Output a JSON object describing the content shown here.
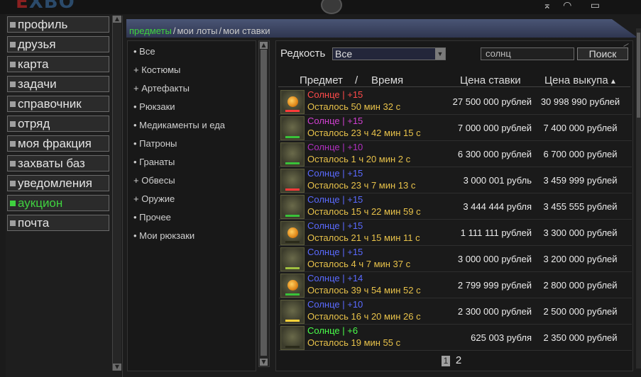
{
  "app": {
    "logo_a": "E",
    "logo_b": "XBO"
  },
  "tray": {
    "signal_icon": "antenna-icon",
    "wifi_icon": "wifi-icon",
    "battery_icon": "battery-icon"
  },
  "nav": {
    "items": [
      {
        "label": "профиль"
      },
      {
        "label": "друзья"
      },
      {
        "label": "карта"
      },
      {
        "label": "задачи"
      },
      {
        "label": "справочник"
      },
      {
        "label": "отряд"
      },
      {
        "label": "моя фракция"
      },
      {
        "label": "захваты баз"
      },
      {
        "label": "уведомления"
      },
      {
        "label": "аукцион",
        "active": true
      },
      {
        "label": "почта"
      }
    ]
  },
  "tabs": {
    "items": [
      "предметы",
      "мои лоты",
      "мои ставки"
    ],
    "separator": "/"
  },
  "categories": [
    "• Все",
    "+ Костюмы",
    "+ Артефакты",
    "• Рюкзаки",
    "• Медикаменты и еда",
    "• Патроны",
    "• Гранаты",
    "+ Обвесы",
    "+ Оружие",
    "• Прочее",
    "• Мои рюкзаки"
  ],
  "filter": {
    "rarity_label": "Редкость",
    "rarity_value": "Все",
    "search_value": "солнц",
    "search_button": "Поиск"
  },
  "table": {
    "headers": {
      "item": "Предмет",
      "slash": "/",
      "time": "Время",
      "bid": "Цена ставки",
      "buyout": "Цена выкупа",
      "sort_indicator": "▴"
    },
    "rows": [
      {
        "name": "Солнце | +15",
        "name_color": "#ff4a4a",
        "remaining": "Осталось 50 мин 32 с",
        "bid": "27 500 000 рублей",
        "buyout": "30 998 990 рублей",
        "bar_color": "#ff3a3a",
        "has_orb": true
      },
      {
        "name": "Солнце | +15",
        "name_color": "#d040d0",
        "remaining": "Осталось 23 ч 42 мин 15 с",
        "bid": "7 000 000 рублей",
        "buyout": "7 400 000 рублей",
        "bar_color": "#39c239",
        "has_orb": false
      },
      {
        "name": "Солнце | +10",
        "name_color": "#b030c0",
        "remaining": "Осталось 1 ч 20 мин 2 с",
        "bid": "6 300 000 рублей",
        "buyout": "6 700 000 рублей",
        "bar_color": "#39c239",
        "has_orb": false
      },
      {
        "name": "Солнце | +15",
        "name_color": "#5a6aff",
        "remaining": "Осталось 23 ч 7 мин 13 с",
        "bid": "3 000 001 рубль",
        "buyout": "3 459 999 рублей",
        "bar_color": "#ff3a3a",
        "has_orb": false
      },
      {
        "name": "Солнце | +15",
        "name_color": "#5a6aff",
        "remaining": "Осталось 15 ч 22 мин 59 с",
        "bid": "3 444 444 рубля",
        "buyout": "3 455 555 рублей",
        "bar_color": "#39c239",
        "has_orb": false
      },
      {
        "name": "Солнце | +15",
        "name_color": "#5a6aff",
        "remaining": "Осталось 21 ч 15 мин 11 с",
        "bid": "1 111 111 рублей",
        "buyout": "3 300 000 рублей",
        "bar_color": "#2a2a1a",
        "has_orb": true
      },
      {
        "name": "Солнце | +15",
        "name_color": "#5a6aff",
        "remaining": "Осталось 4 ч 7 мин 37 с",
        "bid": "3 000 000 рублей",
        "buyout": "3 200 000 рублей",
        "bar_color": "#a0c040",
        "has_orb": false
      },
      {
        "name": "Солнце | +14",
        "name_color": "#5a6aff",
        "remaining": "Осталось 39 ч 54 мин 52 с",
        "bid": "2 799 999 рублей",
        "buyout": "2 800 000 рублей",
        "bar_color": "#39c239",
        "has_orb": true
      },
      {
        "name": "Солнце | +10",
        "name_color": "#5a6aff",
        "remaining": "Осталось 16 ч 20 мин 26 с",
        "bid": "2 300 000 рублей",
        "buyout": "2 500 000 рублей",
        "bar_color": "#ffd23a",
        "has_orb": false
      },
      {
        "name": "Солнце | +6",
        "name_color": "#4aff4a",
        "remaining": "Осталось 19 мин 55 с",
        "bid": "625 003 рубля",
        "buyout": "2 350 000 рублей",
        "bar_color": "#2a2a1a",
        "has_orb": false
      }
    ]
  },
  "pagination": {
    "pages": [
      "1",
      "2"
    ],
    "current": "1"
  }
}
